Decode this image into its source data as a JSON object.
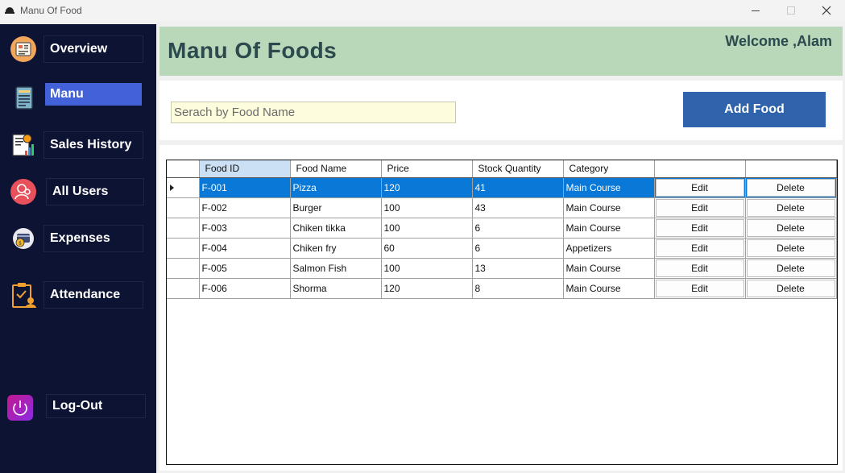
{
  "window": {
    "title": "Manu Of Food"
  },
  "sidebar": {
    "items": [
      {
        "label": "Overview",
        "icon": "overview-icon",
        "active": false
      },
      {
        "label": "Manu",
        "icon": "menu-card-icon",
        "active": true
      },
      {
        "label": "Sales History",
        "icon": "sales-chart-icon",
        "active": false
      },
      {
        "label": "All Users",
        "icon": "users-icon",
        "active": false
      },
      {
        "label": "Expenses",
        "icon": "expenses-icon",
        "active": false
      },
      {
        "label": "Attendance",
        "icon": "attendance-icon",
        "active": false
      },
      {
        "label": "Log-Out",
        "icon": "power-icon",
        "active": false
      }
    ]
  },
  "header": {
    "title": "Manu Of Foods",
    "welcome": "Welcome ,Alam"
  },
  "toolbar": {
    "search_placeholder": "Serach by Food Name",
    "add_label": "Add Food"
  },
  "table": {
    "columns": [
      "Food ID",
      "Food Name",
      "Price",
      "Stock Quantity",
      "Category",
      "",
      ""
    ],
    "edit_label": "Edit",
    "delete_label": "Delete",
    "rows": [
      {
        "id": "F-001",
        "name": "Pizza",
        "price": "120",
        "stock": "41",
        "category": "Main Course"
      },
      {
        "id": "F-002",
        "name": "Burger",
        "price": "100",
        "stock": "43",
        "category": "Main Course"
      },
      {
        "id": "F-003",
        "name": "Chiken tikka",
        "price": "100",
        "stock": "6",
        "category": "Main Course"
      },
      {
        "id": "F-004",
        "name": "Chiken fry",
        "price": "60",
        "stock": "6",
        "category": "Appetizers"
      },
      {
        "id": "F-005",
        "name": "Salmon Fish",
        "price": "100",
        "stock": "13",
        "category": "Main Course"
      },
      {
        "id": "F-006",
        "name": "Shorma",
        "price": "120",
        "stock": "8",
        "category": "Main Course"
      }
    ]
  },
  "colors": {
    "sidebar_bg": "#0d1333",
    "active_nav": "#4361d9",
    "header_bg": "#b9d8b9",
    "add_button": "#2f63ab",
    "row_selected": "#0a78d7"
  }
}
